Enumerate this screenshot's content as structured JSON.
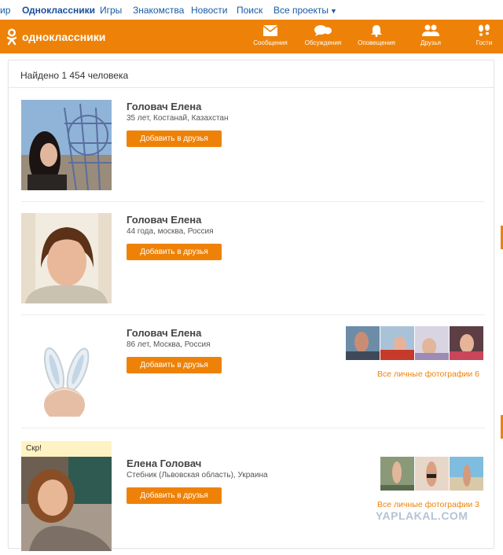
{
  "topnav": {
    "items": [
      "ир",
      "Одноклассники",
      "Игры",
      "Знакомства",
      "Новости",
      "Поиск",
      "Все проекты"
    ]
  },
  "header": {
    "logo": "одноклассники",
    "nav": [
      "Сообщения",
      "Обсуждения",
      "Оповещения",
      "Друзья",
      "Гости"
    ]
  },
  "search": {
    "found": "Найдено 1 454 человека"
  },
  "results": [
    {
      "name": "Головач Елена",
      "info": "35 лет, Костанай, Казахстан",
      "button": "Добавить в друзья"
    },
    {
      "name": "Головач Елена",
      "info": "44 года, москва, Россия",
      "button": "Добавить в друзья"
    },
    {
      "name": "Головач Елена",
      "info": "86 лет, Москва, Россия",
      "button": "Добавить в друзья",
      "photos_link": "Все личные фотографии 6"
    },
    {
      "name": "Елена Головач",
      "info": "Стебник (Львовская область), Украина",
      "button": "Добавить в друзья",
      "photos_link": "Все личные фотографии 3",
      "tag": "Скр!"
    }
  ],
  "watermark": "YAPLAKAL.COM",
  "colors": {
    "accent": "#ee8208",
    "link": "#1a5aa5"
  }
}
